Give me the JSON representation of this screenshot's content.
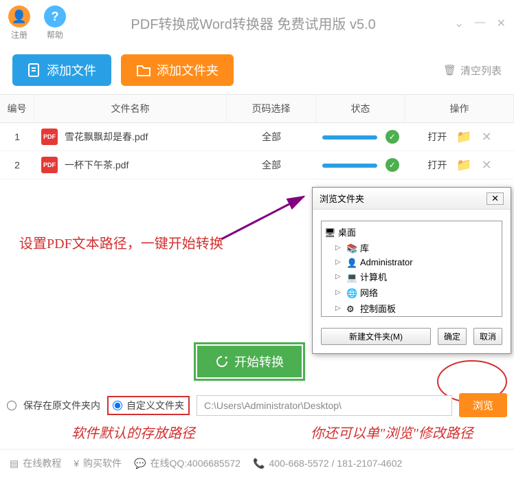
{
  "header": {
    "register": "注册",
    "help": "帮助",
    "title": "PDF转换成Word转换器 免费试用版 v5.0"
  },
  "toolbar": {
    "add_file": "添加文件",
    "add_folder": "添加文件夹",
    "clear_list": "清空列表"
  },
  "columns": {
    "num": "编号",
    "name": "文件名称",
    "page": "页码选择",
    "status": "状态",
    "op": "操作"
  },
  "rows": [
    {
      "num": "1",
      "name": "雪花飘飘却是春.pdf",
      "page": "全部",
      "open": "打开"
    },
    {
      "num": "2",
      "name": "一杯下午茶.pdf",
      "page": "全部",
      "open": "打开"
    }
  ],
  "annotations": {
    "main": "设置PDF文本路径，一键开始转换",
    "default_path": "软件默认的存放路径",
    "browse_hint": "你还可以单\"浏览\"修改路径"
  },
  "start_btn": "开始转换",
  "dialog": {
    "title": "浏览文件夹",
    "tree": [
      "桌面",
      "库",
      "Administrator",
      "计算机",
      "网络",
      "控制面板"
    ],
    "new_folder": "新建文件夹(M)",
    "ok": "确定",
    "cancel": "取消"
  },
  "save": {
    "opt_same": "保存在原文件夹内",
    "opt_custom": "自定义文件夹",
    "path": "C:\\Users\\Administrator\\Desktop\\",
    "browse": "浏览"
  },
  "footer": {
    "tutorial": "在线教程",
    "buy": "购买软件",
    "qq": "在线QQ:4006685572",
    "phone": "400-668-5572 / 181-2107-4602"
  }
}
